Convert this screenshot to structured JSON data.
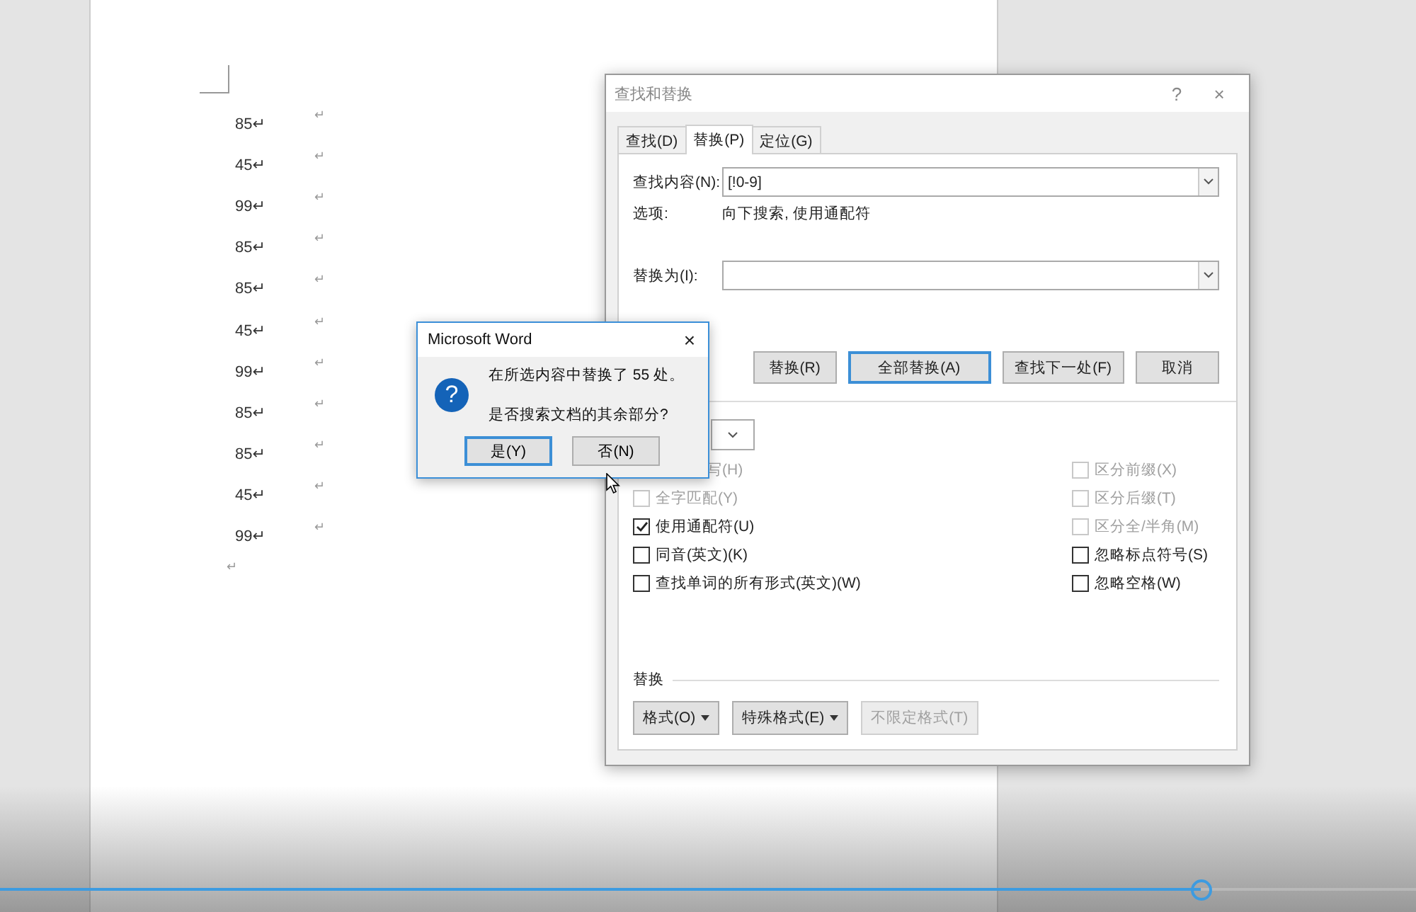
{
  "document": {
    "lines": [
      {
        "number": "85↵",
        "mark": "↵"
      },
      {
        "number": "45↵",
        "mark": "↵"
      },
      {
        "number": "99↵",
        "mark": "↵"
      },
      {
        "number": "85↵",
        "mark": "↵"
      },
      {
        "number": "85↵",
        "mark": "↵"
      },
      {
        "number": "45↵",
        "mark": "↵"
      },
      {
        "number": "99↵",
        "mark": "↵"
      },
      {
        "number": "85↵",
        "mark": "↵"
      },
      {
        "number": "85↵",
        "mark": "↵"
      },
      {
        "number": "45↵",
        "mark": "↵"
      },
      {
        "number": "99↵",
        "mark": "↵"
      }
    ],
    "end_mark": "↵"
  },
  "find_replace": {
    "title": "查找和替换",
    "help": "?",
    "close": "×",
    "tabs": [
      {
        "label": "查找(D)",
        "selected": false
      },
      {
        "label": "替换(P)",
        "selected": true
      },
      {
        "label": "定位(G)",
        "selected": false
      }
    ],
    "find_label": "查找内容(N):",
    "find_value": "[!0-9]",
    "options_label": "选项:",
    "options_value": "向下搜索, 使用通配符",
    "replace_label": "替换为(I):",
    "buttons": [
      {
        "label": "替换(R)",
        "focused": false
      },
      {
        "label": "全部替换(A)",
        "focused": true
      },
      {
        "label": "查找下一处(F)",
        "focused": false
      },
      {
        "label": "取消",
        "focused": false
      }
    ],
    "checkboxes_left": [
      {
        "kind": "partial",
        "label": "写(H)",
        "disabled": true
      },
      {
        "kind": "checkbox",
        "label": "全字匹配(Y)",
        "checked": false,
        "disabled": true
      },
      {
        "kind": "checkbox",
        "label": "使用通配符(U)",
        "checked": true,
        "disabled": false
      },
      {
        "kind": "checkbox",
        "label": "同音(英文)(K)",
        "checked": false,
        "disabled": false
      },
      {
        "kind": "checkbox",
        "label": "查找单词的所有形式(英文)(W)",
        "checked": false,
        "disabled": false
      }
    ],
    "checkboxes_right": [
      {
        "kind": "checkbox",
        "label": "区分前缀(X)",
        "checked": false,
        "disabled": true
      },
      {
        "kind": "checkbox",
        "label": "区分后缀(T)",
        "checked": false,
        "disabled": true
      },
      {
        "kind": "checkbox",
        "label": "区分全/半角(M)",
        "checked": false,
        "disabled": true
      },
      {
        "kind": "checkbox",
        "label": "忽略标点符号(S)",
        "checked": false,
        "disabled": false
      },
      {
        "kind": "checkbox",
        "label": "忽略空格(W)",
        "checked": false,
        "disabled": false
      }
    ],
    "replace_section": "替换",
    "format_buttons": [
      {
        "label": "格式(O)",
        "dropdown": true,
        "disabled": false
      },
      {
        "label": "特殊格式(E)",
        "dropdown": true,
        "disabled": false
      },
      {
        "label": "不限定格式(T)",
        "dropdown": false,
        "disabled": true
      }
    ]
  },
  "message_box": {
    "title": "Microsoft Word",
    "close": "×",
    "icon": "?",
    "lines": [
      "在所选内容中替换了 55 处。",
      "是否搜索文档的其余部分?"
    ],
    "buttons": [
      {
        "label": "是(Y)",
        "focused": true
      },
      {
        "label": "否(N)",
        "focused": false
      }
    ]
  },
  "video_progress": {
    "level": 0.848
  }
}
